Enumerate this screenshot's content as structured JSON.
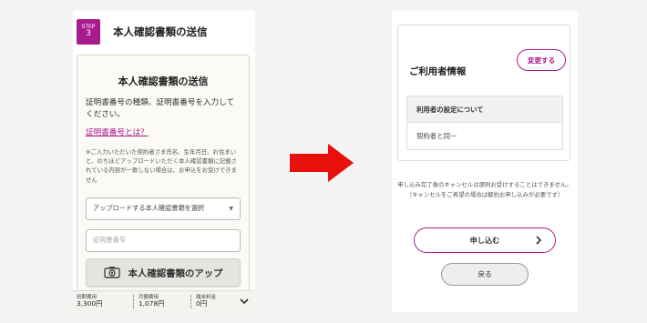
{
  "left_screen": {
    "step": {
      "label": "STEP",
      "number": "3"
    },
    "header_title": "本人確認書類の送信",
    "card_title": "本人確認書類の送信",
    "description": "証明書番号の種類、証明書番号を入力してください。",
    "help_link": "証明書番号とは？",
    "note": "※ご入力いただいた契約者さま氏名、生年月日、お住まいと、のちほどアップロードいただく本人確認書類に記載されている内容が一致しない場合は、お申込をお受けできません",
    "select_placeholder": "アップロードする本人確認書類を選択",
    "input_placeholder": "証明書番号",
    "upload_button": "本人確認書類のアップ",
    "fees": [
      {
        "label": "初期費用",
        "value": "3,300円"
      },
      {
        "label": "月額費用",
        "value": "1,078円"
      },
      {
        "label": "端末料金",
        "value": "0円"
      }
    ]
  },
  "right_screen": {
    "section_title": "ご利用者情報",
    "change_button": "変更する",
    "table": {
      "header": "利用者の設定について",
      "value": "契約者と同一"
    },
    "cancel_note_line1": "申し込み完了後のキャンセルは原則お受けすることはできません。",
    "cancel_note_line2": "（キャンセルをご希望の場合は解約お申し込みが必要です）",
    "apply_button": "申し込む",
    "back_button": "戻る"
  },
  "colors": {
    "accent": "#a81b8d",
    "arrow": "#e8100b"
  }
}
